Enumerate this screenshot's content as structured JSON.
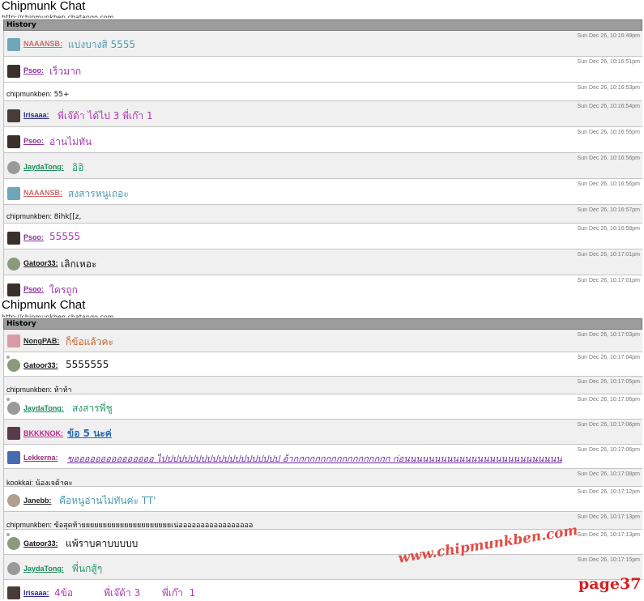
{
  "screens": [
    {
      "title": "Chipmunk Chat",
      "url": "http://chipmunkben.chatango.com",
      "history_label": "History",
      "messages": [
        {
          "user": "NAAANSB:",
          "text": "แบ่งบางสิ 5555",
          "time": "Sun Dec 26, 10:16:49pm",
          "avatar_color": "#6fa7b8",
          "user_color": "#c96a6a",
          "text_color": "#4e9ab0"
        },
        {
          "user": "Psoo:",
          "text": "เร็วมาก",
          "time": "Sun Dec 26, 10:16:51pm",
          "avatar_color": "#3a2f2a",
          "user_color": "#8a2d9a",
          "text_color": "#a23bb0"
        },
        {
          "anon": "chipmunkben:",
          "text": "55+",
          "time": "Sun Dec 26, 10:16:53pm"
        },
        {
          "user": "Irisaaa:",
          "text": "พี่เจ๊ด้า ได้ไป 3  พี่เก๊า  1",
          "time": "Sun Dec 26, 10:16:54pm",
          "avatar_color": "#4a3b3b",
          "user_color": "#2a2a8a",
          "text_color": "#b03ab0"
        },
        {
          "user": "Psoo:",
          "text": "อ่านไม่ทัน",
          "time": "Sun Dec 26, 10:16:55pm",
          "avatar_color": "#3a2f2a",
          "user_color": "#8a2d9a",
          "text_color": "#a23bb0"
        },
        {
          "user": "JaydaTong:",
          "text": "อิอิ",
          "time": "Sun Dec 26, 10:16:56pm",
          "avatar_color": "#9a9a9a",
          "user_color": "#1a8a5a",
          "text_color": "#2a9a6a"
        },
        {
          "user": "NAAANSB:",
          "text": "สงสารหนูเถอะ",
          "time": "Sun Dec 26, 10:16:56pm",
          "avatar_color": "#6fa7b8",
          "user_color": "#c96a6a",
          "text_color": "#4e9ab0"
        },
        {
          "anon": "chipmunkben:",
          "text": "8ihk[[z,",
          "time": "Sun Dec 26, 10:16:57pm"
        },
        {
          "user": "Psoo:",
          "text": "55555",
          "time": "Sun Dec 26, 10:16:58pm",
          "avatar_color": "#3a2f2a",
          "user_color": "#8a2d9a",
          "text_color": "#a23bb0"
        },
        {
          "user": "Gatoor33:",
          "text": "เลิกเหอะ",
          "time": "Sun Dec 26, 10:17:01pm",
          "avatar_color": "#8a9a7a",
          "user_color": "#111111",
          "text_color": "#111111"
        },
        {
          "user": "Psoo:",
          "text": "ใครถูก",
          "time": "Sun Dec 26, 10:17:01pm",
          "avatar_color": "#3a2f2a",
          "user_color": "#8a2d9a",
          "text_color": "#a23bb0"
        }
      ]
    },
    {
      "title": "Chipmunk Chat",
      "url": "http://chipmunkben.chatango.com",
      "history_label": "History",
      "messages": [
        {
          "user": "NongPAB:",
          "text": "ก็ข้อแล้วคะ",
          "time": "Sun Dec 26, 10:17:03pm",
          "avatar_color": "#d89aa8",
          "user_color": "#222222",
          "text_color": "#c0632a"
        },
        {
          "user": "Gatoor33:",
          "text": "5555555",
          "time": "Sun Dec 26, 10:17:04pm",
          "avatar_color": "#8a9a7a",
          "user_color": "#111111",
          "text_color": "#111111"
        },
        {
          "anon": "chipmunkben:",
          "text": "ห้าห้า",
          "time": "Sun Dec 26, 10:17:05pm"
        },
        {
          "user": "JaydaTong:",
          "text": "สงสารพี่ชู",
          "time": "Sun Dec 26, 10:17:06pm",
          "avatar_color": "#9a9a9a",
          "user_color": "#1a8a5a",
          "text_color": "#2a9a6a"
        },
        {
          "user": "BKKKNOK:",
          "text": "ข้อ 5 นะค่",
          "time": "Sun Dec 26, 10:17:06pm",
          "avatar_color": "#5a3a4a",
          "user_color": "#c0288a",
          "text_color": "#2a6ab0"
        },
        {
          "user": "Lekkerna:",
          "text": "ขอออออออออออออออ ไปปปปปปปปปปปปปปปปปปปปป อ้ากกกกกกกกกกกกกกกกกก ก่อนนนนนนนนนนนนนนนนนนนนนนนนนน",
          "time": "Sun Dec 26, 10:17:06pm",
          "avatar_color": "#4a6ab0",
          "user_color": "#a02a7a",
          "text_color": "#6a2aa0"
        },
        {
          "anon": "kookkai:",
          "text": "น้องเจด้าคะ",
          "time": "Sun Dec 26, 10:17:08pm"
        },
        {
          "user": "Janebb:",
          "text": "คือหนูอ่านไม่ทันค่ะ TT'",
          "time": "Sun Dec 26, 10:17:12pm",
          "avatar_color": "#b0a090",
          "user_color": "#222222",
          "text_color": "#4a9ab0"
        },
        {
          "anon": "chipmunkben:",
          "text": "ข้อสุดท้ายยยยยยยยยยยยยยยยยยยยยเน่อออออออออออออออออ",
          "time": "Sun Dec 26, 10:17:13pm"
        },
        {
          "user": "Gatoor33:",
          "text": "แพ้ราบคาบบบบบ",
          "time": "Sun Dec 26, 10:17:13pm",
          "avatar_color": "#8a9a7a",
          "user_color": "#111111",
          "text_color": "#111111"
        },
        {
          "user": "JaydaTong:",
          "text": "พี่นกสู้ๆ",
          "time": "Sun Dec 26, 10:17:15pm",
          "avatar_color": "#9a9a9a",
          "user_color": "#1a8a5a",
          "text_color": "#2a9a6a"
        },
        {
          "user": "Irisaaa:",
          "text": "4ข้อ          พี่เจ๊ด้า 3       พี่เก๊า  1",
          "time": "",
          "avatar_color": "#4a3b3b",
          "user_color": "#2a2a8a",
          "text_color": "#b03ab0"
        }
      ]
    }
  ],
  "watermark": "www.chipmunkben.com",
  "page_label": "page37"
}
